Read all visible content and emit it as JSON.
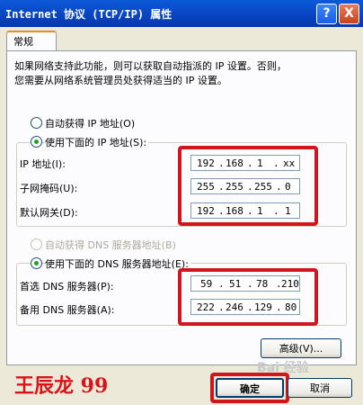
{
  "window": {
    "title": "Internet 协议 (TCP/IP) 属性",
    "help_label": "?",
    "close_label": "X"
  },
  "tabs": [
    {
      "label": "常规"
    }
  ],
  "description": "如果网络支持此功能，则可以获取自动指派的 IP 设置。否则，\n您需要从网络系统管理员处获得适当的 IP 设置。",
  "ip_mode": {
    "auto_label": "自动获得 IP 地址(O)",
    "manual_label": "使用下面的 IP 地址(S):",
    "selected": "manual"
  },
  "ip_fields": [
    {
      "label": "IP 地址(I):",
      "octets": [
        "192",
        "168",
        "1",
        "xx"
      ]
    },
    {
      "label": "子网掩码(U):",
      "octets": [
        "255",
        "255",
        "255",
        "0"
      ]
    },
    {
      "label": "默认网关(D):",
      "octets": [
        "192",
        "168",
        "1",
        "1"
      ]
    }
  ],
  "dns_mode": {
    "auto_label": "自动获得 DNS 服务器地址(B)",
    "manual_label": "使用下面的 DNS 服务器地址(E):",
    "selected": "manual",
    "auto_disabled": true
  },
  "dns_fields": [
    {
      "label": "首选 DNS 服务器(P):",
      "octets": [
        "59",
        "51",
        "78",
        "210"
      ]
    },
    {
      "label": "备用 DNS 服务器(A):",
      "octets": [
        "222",
        "246",
        "129",
        "80"
      ]
    }
  ],
  "buttons": {
    "advanced": "高级(V)...",
    "ok": "确定",
    "cancel": "取消"
  },
  "annotations": {
    "signature": "王辰龙 99",
    "highlight_color": "#d0161c"
  },
  "watermark": "Bai 经验"
}
